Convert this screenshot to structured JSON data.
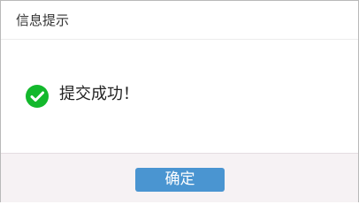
{
  "dialog": {
    "title": "信息提示",
    "message": "提交成功！",
    "confirm_label": "确定",
    "status_icon": "check-circle-icon"
  },
  "colors": {
    "success": "#13b82c",
    "button": "#4a95d1",
    "footer_bg": "#f6f2f4"
  }
}
